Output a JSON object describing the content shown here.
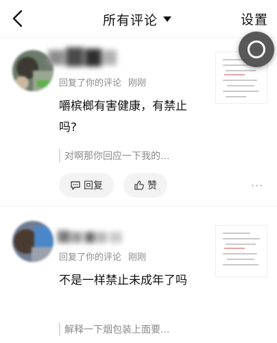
{
  "header": {
    "back_icon": "back-chevron-icon",
    "title": "所有评论",
    "dropdown_icon": "caret-down-icon",
    "settings_label": "设置"
  },
  "floating_button": {
    "icon": "circle-ring-icon"
  },
  "comments": [
    {
      "action_text": "回复了你的评论",
      "time": "刚刚",
      "content": "嚼槟榔有害健康，有禁止吗?",
      "quote": "对啊那你回应一下我的...",
      "reply_label": "回复",
      "like_label": "赞",
      "more_label": "···",
      "reply_icon": "chat-bubble-icon",
      "like_icon": "thumbs-up-icon"
    },
    {
      "action_text": "回复了你的评论",
      "time": "刚刚",
      "content": "不是一样禁止未成年了吗",
      "quote": "解释一下烟包装上面要..."
    }
  ]
}
